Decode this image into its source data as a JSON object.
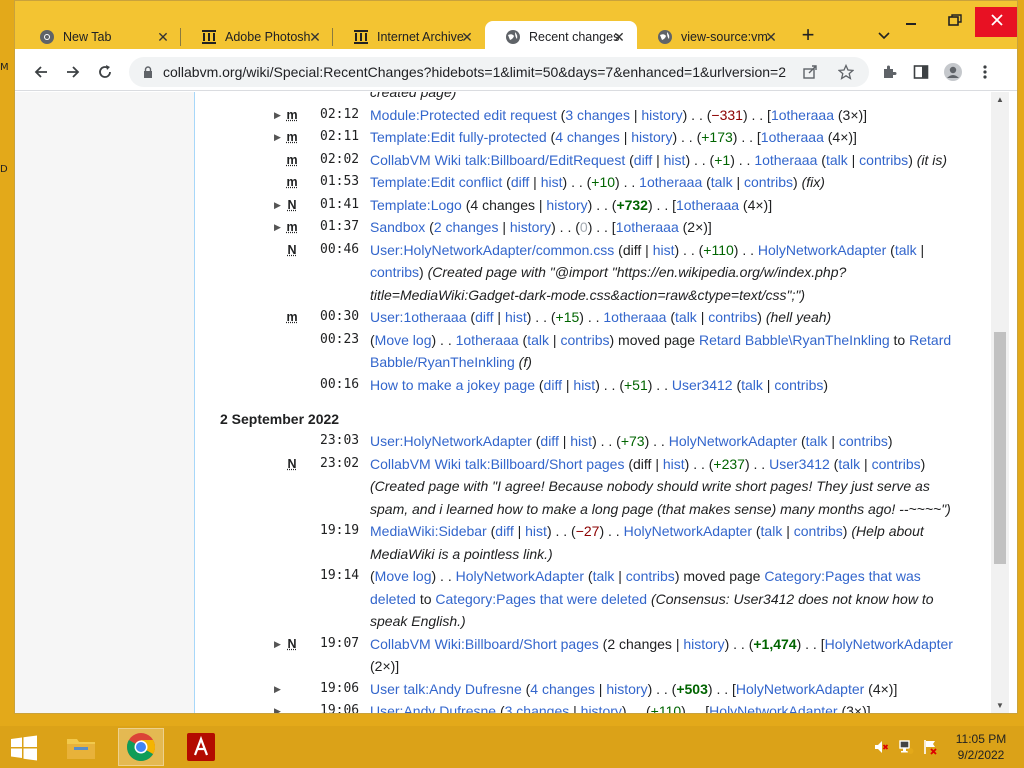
{
  "browser": {
    "tabs": [
      {
        "label": "New Tab",
        "icon": "chrome-icon"
      },
      {
        "label": "Adobe Photosh",
        "icon": "archive-icon"
      },
      {
        "label": "Internet Archive",
        "icon": "archive-icon"
      },
      {
        "label": "Recent changes",
        "icon": "globe-icon"
      },
      {
        "label": "view-source:vm",
        "icon": "globe-icon"
      }
    ],
    "active_tab": 3,
    "url": "collabvm.org/wiki/Special:RecentChanges?hidebots=1&limit=50&days=7&enhanced=1&urlversion=2"
  },
  "changes": [
    {
      "time": "",
      "flag": "",
      "arrow": false,
      "entry": [
        {
          "t": "created page)",
          "c": "cmt"
        }
      ]
    },
    {
      "time": "02:12",
      "flag": "m",
      "arrow": true,
      "entry": [
        {
          "t": "Module:Protected edit request",
          "c": "lnk"
        },
        {
          "t": " ("
        },
        {
          "t": "3 changes",
          "c": "lnk"
        },
        {
          "t": " | "
        },
        {
          "t": "history",
          "c": "lnk"
        },
        {
          "t": ") . . ("
        },
        {
          "t": "−331",
          "c": "neg"
        },
        {
          "t": ") . . ["
        },
        {
          "t": "1otheraaa",
          "c": "lnk"
        },
        {
          "t": " (3×)]"
        }
      ]
    },
    {
      "time": "02:11",
      "flag": "m",
      "arrow": true,
      "entry": [
        {
          "t": "Template:Edit fully-protected",
          "c": "lnk"
        },
        {
          "t": " ("
        },
        {
          "t": "4 changes",
          "c": "lnk"
        },
        {
          "t": " | "
        },
        {
          "t": "history",
          "c": "lnk"
        },
        {
          "t": ") . . ("
        },
        {
          "t": "+173",
          "c": "pos"
        },
        {
          "t": ") . . ["
        },
        {
          "t": "1otheraaa",
          "c": "lnk"
        },
        {
          "t": " (4×)]"
        }
      ]
    },
    {
      "time": "02:02",
      "flag": "m",
      "arrow": false,
      "entry": [
        {
          "t": "CollabVM Wiki talk:Billboard/EditRequest",
          "c": "lnk"
        },
        {
          "t": " ("
        },
        {
          "t": "diff",
          "c": "lnk"
        },
        {
          "t": " | "
        },
        {
          "t": "hist",
          "c": "lnk"
        },
        {
          "t": ") . . ("
        },
        {
          "t": "+1",
          "c": "pos"
        },
        {
          "t": ") . . "
        },
        {
          "t": "1otheraaa",
          "c": "lnk"
        },
        {
          "t": " ("
        },
        {
          "t": "talk",
          "c": "lnk"
        },
        {
          "t": " | "
        },
        {
          "t": "contribs",
          "c": "lnk"
        },
        {
          "t": ") "
        },
        {
          "t": "(it is)",
          "c": "cmt"
        }
      ]
    },
    {
      "time": "01:53",
      "flag": "m",
      "arrow": false,
      "entry": [
        {
          "t": "Template:Edit conflict",
          "c": "lnk"
        },
        {
          "t": " ("
        },
        {
          "t": "diff",
          "c": "lnk"
        },
        {
          "t": " | "
        },
        {
          "t": "hist",
          "c": "lnk"
        },
        {
          "t": ") . . ("
        },
        {
          "t": "+10",
          "c": "pos"
        },
        {
          "t": ") . . "
        },
        {
          "t": "1otheraaa",
          "c": "lnk"
        },
        {
          "t": " ("
        },
        {
          "t": "talk",
          "c": "lnk"
        },
        {
          "t": " | "
        },
        {
          "t": "contribs",
          "c": "lnk"
        },
        {
          "t": ") "
        },
        {
          "t": "(fix)",
          "c": "cmt"
        }
      ]
    },
    {
      "time": "01:41",
      "flag": "N",
      "arrow": true,
      "entry": [
        {
          "t": "Template:Logo",
          "c": "lnk"
        },
        {
          "t": " (4 changes | "
        },
        {
          "t": "history",
          "c": "lnk"
        },
        {
          "t": ") . . ("
        },
        {
          "t": "+732",
          "c": "posb"
        },
        {
          "t": ") . . ["
        },
        {
          "t": "1otheraaa",
          "c": "lnk"
        },
        {
          "t": " (4×)]"
        }
      ]
    },
    {
      "time": "01:37",
      "flag": "m",
      "arrow": true,
      "entry": [
        {
          "t": "Sandbox",
          "c": "lnk"
        },
        {
          "t": " ("
        },
        {
          "t": "2 changes",
          "c": "lnk"
        },
        {
          "t": " | "
        },
        {
          "t": "history",
          "c": "lnk"
        },
        {
          "t": ") . . ("
        },
        {
          "t": "0",
          "c": "zero"
        },
        {
          "t": ") . . ["
        },
        {
          "t": "1otheraaa",
          "c": "lnk"
        },
        {
          "t": " (2×)]"
        }
      ]
    },
    {
      "time": "00:46",
      "flag": "N",
      "arrow": false,
      "entry": [
        {
          "t": "User:HolyNetworkAdapter/common.css",
          "c": "lnk"
        },
        {
          "t": " (diff | "
        },
        {
          "t": "hist",
          "c": "lnk"
        },
        {
          "t": ") . . ("
        },
        {
          "t": "+110",
          "c": "pos"
        },
        {
          "t": ") . . "
        },
        {
          "t": "HolyNetworkAdapter",
          "c": "lnk"
        },
        {
          "t": " ("
        },
        {
          "t": "talk",
          "c": "lnk"
        },
        {
          "t": " | "
        },
        {
          "t": "contribs",
          "c": "lnk"
        },
        {
          "t": ") "
        },
        {
          "t": "(Created page with \"@import \"https://en.wikipedia.org/w/index.php?title=MediaWiki:Gadget-dark-mode.css&action=raw&ctype=text/css\";\")",
          "c": "cmt"
        }
      ]
    },
    {
      "time": "00:30",
      "flag": "m",
      "arrow": false,
      "entry": [
        {
          "t": "User:1otheraaa",
          "c": "lnk"
        },
        {
          "t": " ("
        },
        {
          "t": "diff",
          "c": "lnk"
        },
        {
          "t": " | "
        },
        {
          "t": "hist",
          "c": "lnk"
        },
        {
          "t": ") . . ("
        },
        {
          "t": "+15",
          "c": "pos"
        },
        {
          "t": ") . . "
        },
        {
          "t": "1otheraaa",
          "c": "lnk"
        },
        {
          "t": " ("
        },
        {
          "t": "talk",
          "c": "lnk"
        },
        {
          "t": " | "
        },
        {
          "t": "contribs",
          "c": "lnk"
        },
        {
          "t": ") "
        },
        {
          "t": "(hell yeah)",
          "c": "cmt"
        }
      ]
    },
    {
      "time": "00:23",
      "flag": "",
      "arrow": false,
      "entry": [
        {
          "t": "("
        },
        {
          "t": "Move log",
          "c": "lnk"
        },
        {
          "t": ") . . "
        },
        {
          "t": "1otheraaa",
          "c": "lnk"
        },
        {
          "t": " ("
        },
        {
          "t": "talk",
          "c": "lnk"
        },
        {
          "t": " | "
        },
        {
          "t": "contribs",
          "c": "lnk"
        },
        {
          "t": ") moved page "
        },
        {
          "t": "Retard Babble\\RyanTheInkling",
          "c": "lnk"
        },
        {
          "t": " to "
        },
        {
          "t": "Retard Babble/RyanTheInkling",
          "c": "lnk"
        },
        {
          "t": " "
        },
        {
          "t": "(f)",
          "c": "cmt"
        }
      ]
    },
    {
      "time": "00:16",
      "flag": "",
      "arrow": false,
      "entry": [
        {
          "t": "How to make a jokey page",
          "c": "lnk"
        },
        {
          "t": " ("
        },
        {
          "t": "diff",
          "c": "lnk"
        },
        {
          "t": " | "
        },
        {
          "t": "hist",
          "c": "lnk"
        },
        {
          "t": ") . . ("
        },
        {
          "t": "+51",
          "c": "pos"
        },
        {
          "t": ") . . "
        },
        {
          "t": "User3412",
          "c": "lnk"
        },
        {
          "t": " ("
        },
        {
          "t": "talk",
          "c": "lnk"
        },
        {
          "t": " | "
        },
        {
          "t": "contribs",
          "c": "lnk"
        },
        {
          "t": ")"
        }
      ]
    }
  ],
  "date_heading": "2 September 2022",
  "changes_sep2": [
    {
      "time": "23:03",
      "flag": "",
      "arrow": false,
      "entry": [
        {
          "t": "User:HolyNetworkAdapter",
          "c": "lnk"
        },
        {
          "t": " ("
        },
        {
          "t": "diff",
          "c": "lnk"
        },
        {
          "t": " | "
        },
        {
          "t": "hist",
          "c": "lnk"
        },
        {
          "t": ") . . ("
        },
        {
          "t": "+73",
          "c": "pos"
        },
        {
          "t": ") . . "
        },
        {
          "t": "HolyNetworkAdapter",
          "c": "lnk"
        },
        {
          "t": " ("
        },
        {
          "t": "talk",
          "c": "lnk"
        },
        {
          "t": " | "
        },
        {
          "t": "contribs",
          "c": "lnk"
        },
        {
          "t": ")"
        }
      ]
    },
    {
      "time": "23:02",
      "flag": "N",
      "arrow": false,
      "entry": [
        {
          "t": "CollabVM Wiki talk:Billboard/Short pages",
          "c": "lnk"
        },
        {
          "t": " (diff | "
        },
        {
          "t": "hist",
          "c": "lnk"
        },
        {
          "t": ") . . ("
        },
        {
          "t": "+237",
          "c": "pos"
        },
        {
          "t": ") . . "
        },
        {
          "t": "User3412",
          "c": "lnk"
        },
        {
          "t": " ("
        },
        {
          "t": "talk",
          "c": "lnk"
        },
        {
          "t": " | "
        },
        {
          "t": "contribs",
          "c": "lnk"
        },
        {
          "t": ") "
        },
        {
          "t": "(Created page with \"I agree! Because nobody should write short pages! They just serve as spam, and i learned how to make a long page (that makes sense) many months ago! --~~~~\")",
          "c": "cmt"
        }
      ]
    },
    {
      "time": "19:19",
      "flag": "",
      "arrow": false,
      "entry": [
        {
          "t": "MediaWiki:Sidebar",
          "c": "lnk"
        },
        {
          "t": " ("
        },
        {
          "t": "diff",
          "c": "lnk"
        },
        {
          "t": " | "
        },
        {
          "t": "hist",
          "c": "lnk"
        },
        {
          "t": ") . . ("
        },
        {
          "t": "−27",
          "c": "neg"
        },
        {
          "t": ") . . "
        },
        {
          "t": "HolyNetworkAdapter",
          "c": "lnk"
        },
        {
          "t": " ("
        },
        {
          "t": "talk",
          "c": "lnk"
        },
        {
          "t": " | "
        },
        {
          "t": "contribs",
          "c": "lnk"
        },
        {
          "t": ") "
        },
        {
          "t": "(Help about MediaWiki is a pointless link.)",
          "c": "cmt"
        }
      ]
    },
    {
      "time": "19:14",
      "flag": "",
      "arrow": false,
      "entry": [
        {
          "t": "("
        },
        {
          "t": "Move log",
          "c": "lnk"
        },
        {
          "t": ") . . "
        },
        {
          "t": "HolyNetworkAdapter",
          "c": "lnk"
        },
        {
          "t": " ("
        },
        {
          "t": "talk",
          "c": "lnk"
        },
        {
          "t": " | "
        },
        {
          "t": "contribs",
          "c": "lnk"
        },
        {
          "t": ") moved page "
        },
        {
          "t": "Category:Pages that was deleted",
          "c": "lnk"
        },
        {
          "t": " to "
        },
        {
          "t": "Category:Pages that were deleted",
          "c": "lnk"
        },
        {
          "t": " "
        },
        {
          "t": "(Consensus: User3412 does not know how to speak English.)",
          "c": "cmt"
        }
      ]
    },
    {
      "time": "19:07",
      "flag": "N",
      "arrow": true,
      "entry": [
        {
          "t": "CollabVM Wiki:Billboard/Short pages",
          "c": "lnk"
        },
        {
          "t": " (2 changes | "
        },
        {
          "t": "history",
          "c": "lnk"
        },
        {
          "t": ") . . ("
        },
        {
          "t": "+1,474",
          "c": "posb"
        },
        {
          "t": ") . . ["
        },
        {
          "t": "HolyNetworkAdapter",
          "c": "lnk"
        },
        {
          "t": " (2×)]"
        }
      ]
    },
    {
      "time": "19:06",
      "flag": "",
      "arrow": true,
      "entry": [
        {
          "t": "User talk:Andy Dufresne",
          "c": "lnk"
        },
        {
          "t": " ("
        },
        {
          "t": "4 changes",
          "c": "lnk"
        },
        {
          "t": " | "
        },
        {
          "t": "history",
          "c": "lnk"
        },
        {
          "t": ") . . ("
        },
        {
          "t": "+503",
          "c": "posb"
        },
        {
          "t": ") . . ["
        },
        {
          "t": "HolyNetworkAdapter",
          "c": "lnk"
        },
        {
          "t": " (4×)]"
        }
      ]
    },
    {
      "time": "19:06",
      "flag": "",
      "arrow": true,
      "entry": [
        {
          "t": "User:Andy Dufresne",
          "c": "lnk"
        },
        {
          "t": " ("
        },
        {
          "t": "3 changes",
          "c": "lnk"
        },
        {
          "t": " | "
        },
        {
          "t": "history",
          "c": "lnk"
        },
        {
          "t": ") . . ("
        },
        {
          "t": "+110",
          "c": "pos"
        },
        {
          "t": ") . . ["
        },
        {
          "t": "HolyNetworkAdapter",
          "c": "lnk"
        },
        {
          "t": " (3×)]"
        }
      ]
    }
  ],
  "taskbar": {
    "time": "11:05 PM",
    "date": "9/2/2022"
  }
}
